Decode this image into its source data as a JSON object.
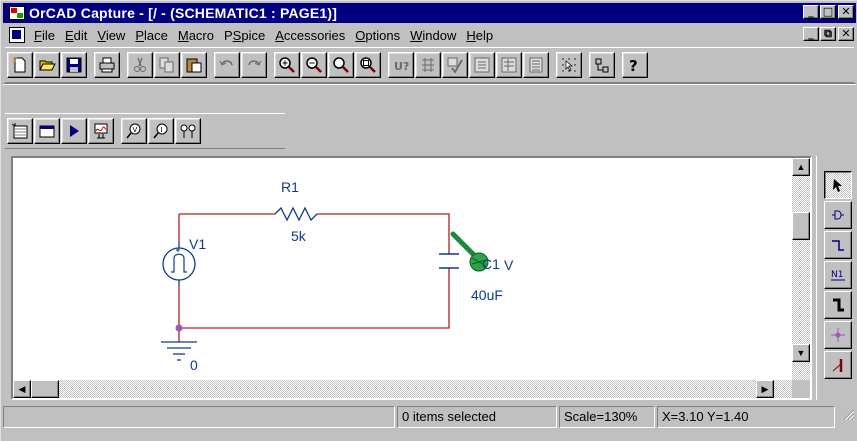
{
  "window": {
    "title": "OrCAD Capture - [/ - (SCHEMATIC1 : PAGE1)]",
    "caption_buttons": {
      "minimize": "_",
      "restore": "□",
      "close": "✕"
    }
  },
  "menubar": {
    "items": [
      {
        "label": "File",
        "hotkey": "F",
        "rest": "ile"
      },
      {
        "label": "Edit",
        "hotkey": "E",
        "rest": "dit"
      },
      {
        "label": "View",
        "hotkey": "V",
        "rest": "iew"
      },
      {
        "label": "Place",
        "hotkey": "P",
        "rest": "lace"
      },
      {
        "label": "Macro",
        "hotkey": "M",
        "rest": "acro"
      },
      {
        "label": "PSpice",
        "pre": "P",
        "hotkey": "S",
        "rest": "pice"
      },
      {
        "label": "Accessories",
        "hotkey": "A",
        "rest": "ccessories"
      },
      {
        "label": "Options",
        "hotkey": "O",
        "rest": "ptions"
      },
      {
        "label": "Window",
        "hotkey": "W",
        "rest": "indow"
      },
      {
        "label": "Help",
        "hotkey": "H",
        "rest": "elp"
      }
    ],
    "doc_buttons": {
      "minimize": "_",
      "restore": "⧉",
      "close": "✕"
    }
  },
  "toolbar_main": [
    "new-icon",
    "open-icon",
    "save-icon",
    "print-icon",
    "cut-icon",
    "copy-icon",
    "paste-icon",
    "undo-icon",
    "redo-icon",
    "zoom-in-icon",
    "zoom-out-icon",
    "zoom-area-icon",
    "zoom-all-icon",
    "annotate-icon",
    "back-annotate-icon",
    "drc-icon",
    "netlist-icon",
    "cross-reference-icon",
    "bill-of-materials-icon",
    "snap-to-grid-icon",
    "project-manager-icon",
    "help-icon"
  ],
  "toolbar_pspice": [
    "new-simulation-profile-icon",
    "edit-simulation-profile-icon",
    "run-pspice-icon",
    "view-simulation-results-icon",
    "voltage-marker-icon",
    "current-marker-icon",
    "differential-voltage-marker-icon"
  ],
  "schematic": {
    "parts": {
      "r1": {
        "ref": "R1",
        "value": "5k"
      },
      "v1": {
        "ref": "V1"
      },
      "c1": {
        "ref": "C1",
        "value": "40uF"
      },
      "ground": {
        "value": "0"
      }
    },
    "marker_label": "V"
  },
  "palette": [
    "select-icon",
    "place-part-icon",
    "place-wire-icon",
    "place-net-alias-icon",
    "place-bus-icon",
    "place-junction-icon",
    "place-bus-entry-icon"
  ],
  "statusbar": {
    "message": "",
    "selection": "0 items selected",
    "scale": "Scale=130%",
    "coords": "X=3.10  Y=1.40"
  },
  "colors": {
    "titlebar": "#000080",
    "wire": "#b02020",
    "part_outline": "#0d3b8a",
    "junction": "#9b59b6",
    "marker": "#1a8a3a"
  }
}
